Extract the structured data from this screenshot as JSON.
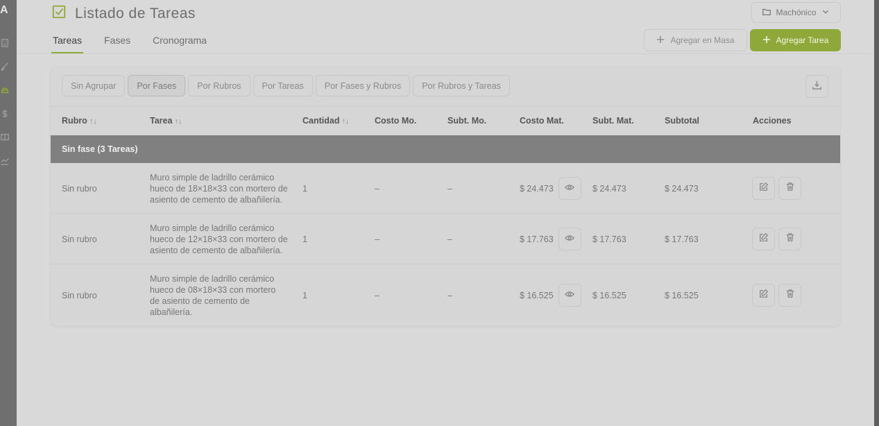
{
  "left_rail": {
    "logo": "A",
    "icons": [
      "building-icon",
      "brush-icon",
      "budget-icon",
      "dollar-icon",
      "book-icon",
      "chart-icon"
    ]
  },
  "header": {
    "title": "Listado de Tareas",
    "project_select": "Machónico"
  },
  "tabs": [
    {
      "label": "Tareas",
      "active": true
    },
    {
      "label": "Fases",
      "active": false
    },
    {
      "label": "Cronograma",
      "active": false
    }
  ],
  "toolbar": {
    "bulk_label": "Agregar en Masa",
    "add_label": "Agregar Tarea"
  },
  "colors": {
    "accent": "#8fa83a",
    "group_header": "#808080"
  },
  "grouping": [
    {
      "label": "Sin Agrupar",
      "active": false
    },
    {
      "label": "Por Fases",
      "active": true
    },
    {
      "label": "Por Rubros",
      "active": false
    },
    {
      "label": "Por Tareas",
      "active": false
    },
    {
      "label": "Por Fases y Rubros",
      "active": false
    },
    {
      "label": "Por Rubros y Tareas",
      "active": false
    }
  ],
  "table": {
    "headers": {
      "rubro": "Rubro",
      "tarea": "Tarea",
      "cantidad": "Cantidad",
      "costo_mo": "Costo Mo.",
      "subt_mo": "Subt. Mo.",
      "costo_mat": "Costo Mat.",
      "subt_mat": "Subt. Mat.",
      "subtotal": "Subtotal",
      "acciones": "Acciones"
    },
    "sort_glyph": "↑↓",
    "group_label": "Sin fase (3 Tareas)",
    "rows": [
      {
        "rubro": "Sin rubro",
        "tarea": "Muro simple de ladrillo cerámico hueco de 18×18×33 con mortero de asiento de cemento de albañilería.",
        "cantidad": "1",
        "costo_mo": "–",
        "subt_mo": "–",
        "costo_mat": "$ 24.473",
        "subt_mat": "$ 24.473",
        "subtotal": "$ 24.473"
      },
      {
        "rubro": "Sin rubro",
        "tarea": "Muro simple de ladrillo cerámico hueco de 12×18×33 con mortero de asiento de cemento de albañilería.",
        "cantidad": "1",
        "costo_mo": "–",
        "subt_mo": "–",
        "costo_mat": "$ 17.763",
        "subt_mat": "$ 17.763",
        "subtotal": "$ 17.763"
      },
      {
        "rubro": "Sin rubro",
        "tarea": "Muro simple de ladrillo cerámico hueco de 08×18×33 con mortero de asiento de cemento de albañilería.",
        "cantidad": "1",
        "costo_mo": "–",
        "subt_mo": "–",
        "costo_mat": "$ 16.525",
        "subt_mat": "$ 16.525",
        "subtotal": "$ 16.525"
      }
    ]
  }
}
